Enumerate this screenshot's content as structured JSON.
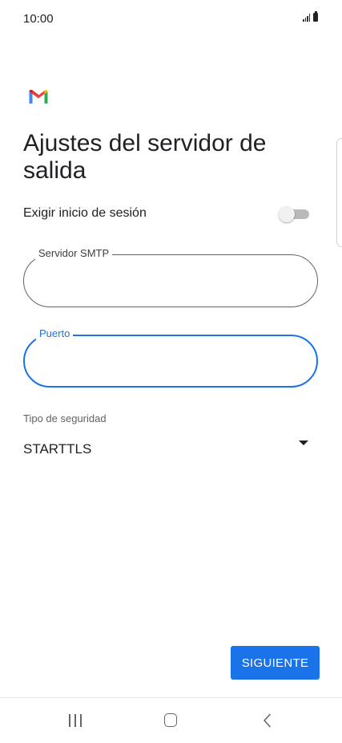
{
  "status_bar": {
    "time": "10:00",
    "icons": [
      "signal-icon",
      "battery-icon"
    ]
  },
  "app": {
    "logo": "gmail-logo"
  },
  "page": {
    "title": "Ajustes del servidor de salida"
  },
  "require_login": {
    "label": "Exigir inicio de sesión",
    "enabled": false
  },
  "smtp_server": {
    "label": "Servidor SMTP",
    "value": ""
  },
  "port": {
    "label": "Puerto",
    "value": "",
    "focused": true
  },
  "security": {
    "label": "Tipo de seguridad",
    "selected": "STARTTLS"
  },
  "actions": {
    "next_label": "SIGUIENTE"
  },
  "nav": {
    "icons": [
      "recent-apps-icon",
      "home-icon",
      "back-icon"
    ]
  },
  "colors": {
    "accent": "#1a73e8",
    "toggle_off": "#b9b9b9",
    "gmail_red": "#ea4335",
    "gmail_blue": "#4285f4",
    "gmail_green": "#34a853",
    "gmail_yellow": "#fbbc04"
  }
}
